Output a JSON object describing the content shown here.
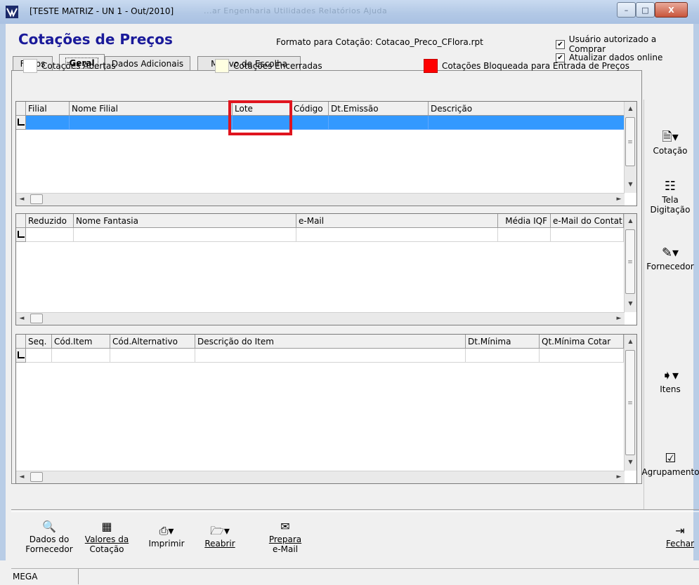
{
  "window": {
    "title": "[TESTE MATRIZ - UN 1 - Out/2010]",
    "ghost_menu": "...ar  Engenharia  Utilidades  Relatórios  Ajuda",
    "min": "–",
    "max": "□",
    "close": "X"
  },
  "header": {
    "title": "Cotações de Preços",
    "format_label": "Formato para Cotação: Cotacao_Preco_CFlora.rpt",
    "chk_authorized": {
      "label": "Usuário autorizado a Comprar",
      "checked": true
    },
    "chk_online": {
      "label": "Atualizar dados online",
      "checked": true
    }
  },
  "tabs": [
    {
      "label": "Filtros"
    },
    {
      "label": "Geral"
    },
    {
      "label": "Dados Adicionais"
    },
    {
      "label": "Motivo de Escolha"
    }
  ],
  "legend": {
    "abertas": {
      "label": "Cotações Abertas",
      "color": "#ffffff"
    },
    "encerradas": {
      "label": "Cotações Encerradas",
      "color": "#ffffe1"
    },
    "bloqueadas": {
      "label": "Cotações Bloqueada para Entrada de Preços",
      "color": "#ff0000"
    }
  },
  "grid_cotacoes": {
    "columns": [
      "Filial",
      "Nome Filial",
      "Lote",
      "Código",
      "Dt.Emissão",
      "Descrição"
    ],
    "selected_color": "#3399ff"
  },
  "grid_fornecedores": {
    "columns": [
      "Reduzido",
      "Nome Fantasia",
      "e-Mail",
      "Média IQF",
      "e-Mail do Contat"
    ]
  },
  "grid_itens": {
    "columns": [
      "Seq.",
      "Cód.Item",
      "Cód.Alternativo",
      "Descrição do Item",
      "Dt.Mínima",
      "Qt.Mínima Cotar"
    ]
  },
  "right_toolbar": {
    "cotacao": "Cotação",
    "tela_line1": "Tela",
    "tela_line2": "Digitação",
    "fornecedor": "Fornecedor",
    "itens": "Itens",
    "agrupamento": "Agrupamento"
  },
  "bottom_toolbar": {
    "dados_line1": "Dados do",
    "dados_line2": "Fornecedor",
    "valores_line1": "Valores da",
    "valores_line2": "Cotação",
    "imprimir": "Imprimir",
    "reabrir": "Reabrir",
    "prepara_line1": "Prepara",
    "prepara_line2": "e-Mail",
    "fechar": "Fechar"
  },
  "status": {
    "company": "MEGA"
  },
  "highlight_color": "#e0141e"
}
